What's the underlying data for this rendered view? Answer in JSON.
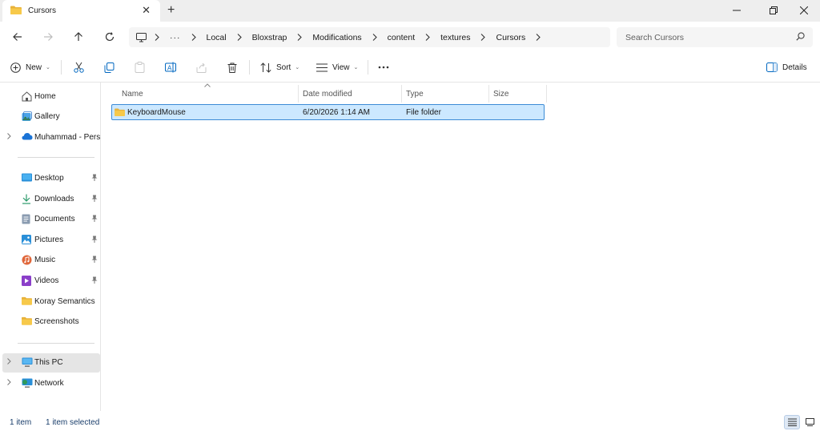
{
  "tab": {
    "title": "Cursors",
    "icon": "folder-icon"
  },
  "breadcrumb": [
    "Local",
    "Bloxstrap",
    "Modifications",
    "content",
    "textures",
    "Cursors"
  ],
  "search": {
    "placeholder": "Search Cursors"
  },
  "toolbar": {
    "new_label": "New",
    "sort_label": "Sort",
    "view_label": "View",
    "details_label": "Details"
  },
  "sidebar": {
    "top": [
      {
        "label": "Home",
        "icon": "home-icon"
      },
      {
        "label": "Gallery",
        "icon": "gallery-icon"
      },
      {
        "label": "Muhammad - Perso",
        "icon": "onedrive-cloud-icon"
      }
    ],
    "quick_access": [
      {
        "label": "Desktop",
        "icon": "desktop-icon",
        "pinned": true
      },
      {
        "label": "Downloads",
        "icon": "download-icon",
        "pinned": true
      },
      {
        "label": "Documents",
        "icon": "documents-icon",
        "pinned": true
      },
      {
        "label": "Pictures",
        "icon": "pictures-icon",
        "pinned": true
      },
      {
        "label": "Music",
        "icon": "music-icon",
        "pinned": true
      },
      {
        "label": "Videos",
        "icon": "videos-icon",
        "pinned": true
      },
      {
        "label": "Koray Semantics",
        "icon": "folder-icon",
        "pinned": false
      },
      {
        "label": "Screenshots",
        "icon": "folder-icon",
        "pinned": false
      }
    ],
    "devices": [
      {
        "label": "This PC",
        "icon": "this-pc-icon",
        "selected": true
      },
      {
        "label": "Network",
        "icon": "network-icon",
        "selected": false
      }
    ]
  },
  "columns": [
    "Name",
    "Date modified",
    "Type",
    "Size"
  ],
  "files": [
    {
      "name": "KeyboardMouse",
      "date_modified": "6/20/2026 1:14 AM",
      "type": "File folder",
      "size": "",
      "selected": true
    }
  ],
  "status": {
    "item_count": "1 item",
    "selection": "1 item selected"
  },
  "colors": {
    "selection_bg": "#cce8ff",
    "selection_border": "#3c8bd6",
    "folder_yellow": "#f7c94a",
    "accent": "#0067c0"
  }
}
